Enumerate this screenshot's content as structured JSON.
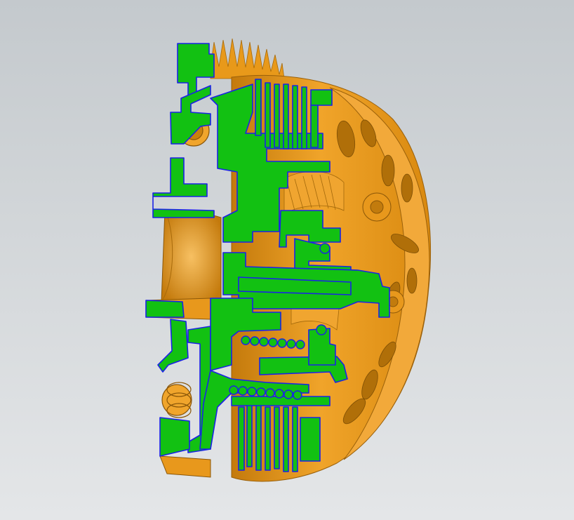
{
  "viewport": {
    "background_top": "#c4c9cd",
    "background_bottom": "#e4e6e8"
  },
  "model": {
    "part_name": "",
    "body_color": "#e89a17",
    "body_shadow": "#c47a0c",
    "body_highlight": "#f5b84a",
    "section_fill": "#10c010",
    "section_edge": "#1020e0"
  }
}
